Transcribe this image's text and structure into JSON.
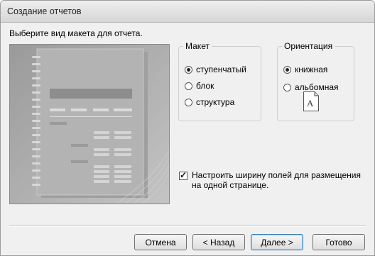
{
  "window": {
    "title": "Создание отчетов"
  },
  "instruction": "Выберите вид макета для отчета.",
  "layout_group": {
    "legend": "Макет",
    "options": [
      {
        "label": "ступенчатый",
        "checked": true
      },
      {
        "label": "блок",
        "checked": false
      },
      {
        "label": "структура",
        "checked": false
      }
    ]
  },
  "orientation_group": {
    "legend": "Ориентация",
    "options": [
      {
        "label": "книжная",
        "checked": true
      },
      {
        "label": "альбомная",
        "checked": false
      }
    ],
    "page_icon_letter": "A"
  },
  "fit_width": {
    "label": "Настроить ширину полей для размещения на одной странице.",
    "checked": true
  },
  "buttons": {
    "cancel": "Отмена",
    "back": "< Назад",
    "next": "Далее >",
    "finish": "Готово"
  }
}
